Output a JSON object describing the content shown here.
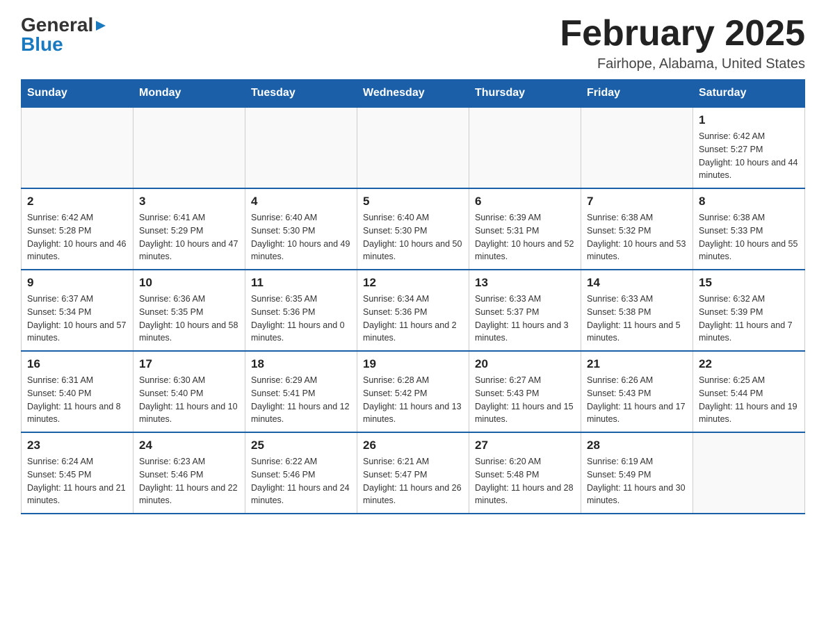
{
  "header": {
    "logo_general": "General",
    "logo_blue": "Blue",
    "month_title": "February 2025",
    "location": "Fairhope, Alabama, United States"
  },
  "days_of_week": [
    "Sunday",
    "Monday",
    "Tuesday",
    "Wednesday",
    "Thursday",
    "Friday",
    "Saturday"
  ],
  "weeks": [
    [
      {
        "day": "",
        "info": ""
      },
      {
        "day": "",
        "info": ""
      },
      {
        "day": "",
        "info": ""
      },
      {
        "day": "",
        "info": ""
      },
      {
        "day": "",
        "info": ""
      },
      {
        "day": "",
        "info": ""
      },
      {
        "day": "1",
        "info": "Sunrise: 6:42 AM\nSunset: 5:27 PM\nDaylight: 10 hours and 44 minutes."
      }
    ],
    [
      {
        "day": "2",
        "info": "Sunrise: 6:42 AM\nSunset: 5:28 PM\nDaylight: 10 hours and 46 minutes."
      },
      {
        "day": "3",
        "info": "Sunrise: 6:41 AM\nSunset: 5:29 PM\nDaylight: 10 hours and 47 minutes."
      },
      {
        "day": "4",
        "info": "Sunrise: 6:40 AM\nSunset: 5:30 PM\nDaylight: 10 hours and 49 minutes."
      },
      {
        "day": "5",
        "info": "Sunrise: 6:40 AM\nSunset: 5:30 PM\nDaylight: 10 hours and 50 minutes."
      },
      {
        "day": "6",
        "info": "Sunrise: 6:39 AM\nSunset: 5:31 PM\nDaylight: 10 hours and 52 minutes."
      },
      {
        "day": "7",
        "info": "Sunrise: 6:38 AM\nSunset: 5:32 PM\nDaylight: 10 hours and 53 minutes."
      },
      {
        "day": "8",
        "info": "Sunrise: 6:38 AM\nSunset: 5:33 PM\nDaylight: 10 hours and 55 minutes."
      }
    ],
    [
      {
        "day": "9",
        "info": "Sunrise: 6:37 AM\nSunset: 5:34 PM\nDaylight: 10 hours and 57 minutes."
      },
      {
        "day": "10",
        "info": "Sunrise: 6:36 AM\nSunset: 5:35 PM\nDaylight: 10 hours and 58 minutes."
      },
      {
        "day": "11",
        "info": "Sunrise: 6:35 AM\nSunset: 5:36 PM\nDaylight: 11 hours and 0 minutes."
      },
      {
        "day": "12",
        "info": "Sunrise: 6:34 AM\nSunset: 5:36 PM\nDaylight: 11 hours and 2 minutes."
      },
      {
        "day": "13",
        "info": "Sunrise: 6:33 AM\nSunset: 5:37 PM\nDaylight: 11 hours and 3 minutes."
      },
      {
        "day": "14",
        "info": "Sunrise: 6:33 AM\nSunset: 5:38 PM\nDaylight: 11 hours and 5 minutes."
      },
      {
        "day": "15",
        "info": "Sunrise: 6:32 AM\nSunset: 5:39 PM\nDaylight: 11 hours and 7 minutes."
      }
    ],
    [
      {
        "day": "16",
        "info": "Sunrise: 6:31 AM\nSunset: 5:40 PM\nDaylight: 11 hours and 8 minutes."
      },
      {
        "day": "17",
        "info": "Sunrise: 6:30 AM\nSunset: 5:40 PM\nDaylight: 11 hours and 10 minutes."
      },
      {
        "day": "18",
        "info": "Sunrise: 6:29 AM\nSunset: 5:41 PM\nDaylight: 11 hours and 12 minutes."
      },
      {
        "day": "19",
        "info": "Sunrise: 6:28 AM\nSunset: 5:42 PM\nDaylight: 11 hours and 13 minutes."
      },
      {
        "day": "20",
        "info": "Sunrise: 6:27 AM\nSunset: 5:43 PM\nDaylight: 11 hours and 15 minutes."
      },
      {
        "day": "21",
        "info": "Sunrise: 6:26 AM\nSunset: 5:43 PM\nDaylight: 11 hours and 17 minutes."
      },
      {
        "day": "22",
        "info": "Sunrise: 6:25 AM\nSunset: 5:44 PM\nDaylight: 11 hours and 19 minutes."
      }
    ],
    [
      {
        "day": "23",
        "info": "Sunrise: 6:24 AM\nSunset: 5:45 PM\nDaylight: 11 hours and 21 minutes."
      },
      {
        "day": "24",
        "info": "Sunrise: 6:23 AM\nSunset: 5:46 PM\nDaylight: 11 hours and 22 minutes."
      },
      {
        "day": "25",
        "info": "Sunrise: 6:22 AM\nSunset: 5:46 PM\nDaylight: 11 hours and 24 minutes."
      },
      {
        "day": "26",
        "info": "Sunrise: 6:21 AM\nSunset: 5:47 PM\nDaylight: 11 hours and 26 minutes."
      },
      {
        "day": "27",
        "info": "Sunrise: 6:20 AM\nSunset: 5:48 PM\nDaylight: 11 hours and 28 minutes."
      },
      {
        "day": "28",
        "info": "Sunrise: 6:19 AM\nSunset: 5:49 PM\nDaylight: 11 hours and 30 minutes."
      },
      {
        "day": "",
        "info": ""
      }
    ]
  ]
}
